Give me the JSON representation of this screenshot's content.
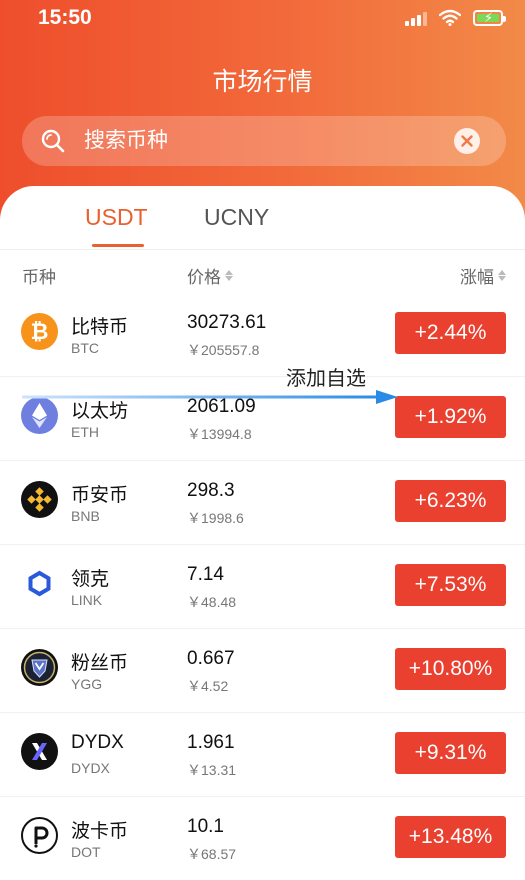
{
  "status_bar": {
    "time": "15:50"
  },
  "header": {
    "title": "市场行情"
  },
  "search": {
    "placeholder": "搜索币种"
  },
  "tabs": [
    {
      "label": "USDT",
      "active": true
    },
    {
      "label": "UCNY",
      "active": false
    }
  ],
  "columns": {
    "coin": "币种",
    "price": "价格",
    "change": "涨幅"
  },
  "colors": {
    "accent": "#e8612f",
    "up": "#e9402f",
    "header_start": "#ee4e2c",
    "header_end": "#f28a48"
  },
  "rows": [
    {
      "name": "比特币",
      "code": "BTC",
      "price": "30273.61",
      "cny": "￥205557.8",
      "change": "+2.44%",
      "icon": "bitcoin-icon"
    },
    {
      "name": "以太坊",
      "code": "ETH",
      "price": "2061.09",
      "cny": "￥13994.8",
      "change": "+1.92%",
      "icon": "ethereum-icon"
    },
    {
      "name": "币安币",
      "code": "BNB",
      "price": "298.3",
      "cny": "￥1998.6",
      "change": "+6.23%",
      "icon": "bnb-icon"
    },
    {
      "name": "领克",
      "code": "LINK",
      "price": "7.14",
      "cny": "￥48.48",
      "change": "+7.53%",
      "icon": "chainlink-icon"
    },
    {
      "name": "粉丝币",
      "code": "YGG",
      "price": "0.667",
      "cny": "￥4.52",
      "change": "+10.80%",
      "icon": "ygg-icon"
    },
    {
      "name": "DYDX",
      "code": "DYDX",
      "price": "1.961",
      "cny": "￥13.31",
      "change": "+9.31%",
      "icon": "dydx-icon"
    },
    {
      "name": "波卡币",
      "code": "DOT",
      "price": "10.1",
      "cny": "￥68.57",
      "change": "+13.48%",
      "icon": "polkadot-icon"
    }
  ],
  "annotation": {
    "text": "添加自选"
  }
}
